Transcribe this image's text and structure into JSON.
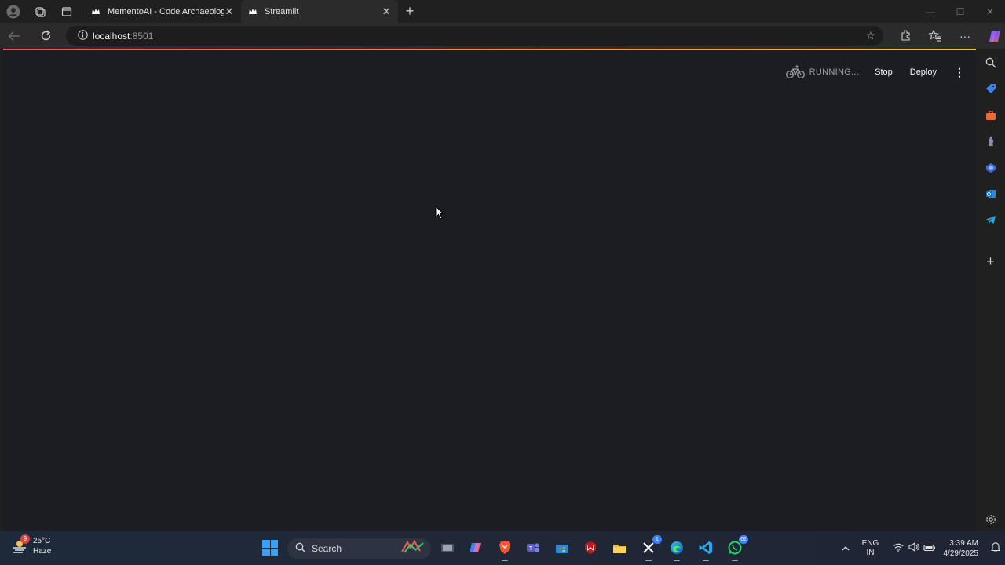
{
  "browser": {
    "tabs": [
      {
        "title": "MementoAI - Code Archaeologist",
        "active": false
      },
      {
        "title": "Streamlit",
        "active": true
      }
    ],
    "url_host": "localhost",
    "url_port": ":8501"
  },
  "streamlit": {
    "status_text": "RUNNING...",
    "stop_label": "Stop",
    "deploy_label": "Deploy",
    "menu_glyph": "⋮",
    "decoration_colors": [
      "#ff4b4b",
      "#ffbd45"
    ],
    "background_color": "#1b1d23"
  },
  "edge_sidebar": {
    "icons": [
      "search-icon",
      "tag-icon",
      "briefcase-icon",
      "chess-icon",
      "copilot-icon",
      "outlook-icon",
      "telegram-icon",
      "add-icon",
      "settings-icon"
    ]
  },
  "taskbar": {
    "weather": {
      "temp": "25°C",
      "condition": "Haze",
      "badge": "9"
    },
    "search_label": "Search",
    "apps": [
      {
        "name": "game-icon"
      },
      {
        "name": "task-view-icon"
      },
      {
        "name": "copilot-icon"
      },
      {
        "name": "brave-icon"
      },
      {
        "name": "teams-icon"
      },
      {
        "name": "store-icon"
      },
      {
        "name": "mcafee-icon"
      },
      {
        "name": "file-explorer-icon"
      },
      {
        "name": "x-icon",
        "badge": "1"
      },
      {
        "name": "edge-icon"
      },
      {
        "name": "vscode-icon"
      },
      {
        "name": "whatsapp-icon",
        "badge": "62"
      }
    ],
    "lang_line1": "ENG",
    "lang_line2": "IN",
    "time": "3:39 AM",
    "date": "4/29/2025"
  }
}
